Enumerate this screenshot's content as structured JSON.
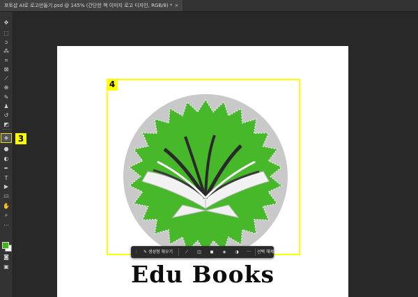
{
  "document": {
    "tab_title": "포토샵 AI로 로고만들기.psd @ 145% (간단한 책 이미지 로고 디자인, RGB/8) *",
    "zoom": "145%",
    "color_mode": "RGB/8"
  },
  "toolbar": {
    "tools": [
      {
        "name": "move-tool",
        "glyph": "✥"
      },
      {
        "name": "marquee-tool",
        "glyph": "⬚"
      },
      {
        "name": "lasso-tool",
        "glyph": "ↄ"
      },
      {
        "name": "magic-wand-tool",
        "glyph": "⁂"
      },
      {
        "name": "crop-tool",
        "glyph": "⌗"
      },
      {
        "name": "frame-tool",
        "glyph": "⊠"
      },
      {
        "name": "eyedropper-tool",
        "glyph": "⟋"
      },
      {
        "name": "healing-brush-tool",
        "glyph": "⊕"
      },
      {
        "name": "brush-tool",
        "glyph": "✎"
      },
      {
        "name": "clone-stamp-tool",
        "glyph": "♟"
      },
      {
        "name": "history-brush-tool",
        "glyph": "↺"
      },
      {
        "name": "eraser-tool",
        "glyph": "◩"
      },
      {
        "name": "paint-bucket-tool",
        "glyph": "◈"
      },
      {
        "name": "blur-tool",
        "glyph": "●"
      },
      {
        "name": "dodge-tool",
        "glyph": "◐"
      },
      {
        "name": "pen-tool",
        "glyph": "✒"
      },
      {
        "name": "type-tool",
        "glyph": "T"
      },
      {
        "name": "path-selection-tool",
        "glyph": "▶"
      },
      {
        "name": "rectangle-tool",
        "glyph": "▭"
      },
      {
        "name": "hand-tool",
        "glyph": "✋"
      },
      {
        "name": "zoom-tool",
        "glyph": "⌕"
      },
      {
        "name": "more-tools",
        "glyph": "···"
      }
    ],
    "foreground_color": "#3fb21c",
    "background_color": "#ffffff"
  },
  "callouts": {
    "tool": "3",
    "selection": "4"
  },
  "context_bar": {
    "generative_fill": "생성형 채우기",
    "deselect": "선택 해제",
    "more": "···"
  },
  "canvas": {
    "brand_text": "Edu Books",
    "logo_green": "#46b82a",
    "logo_circle": "#c9c9c9"
  }
}
